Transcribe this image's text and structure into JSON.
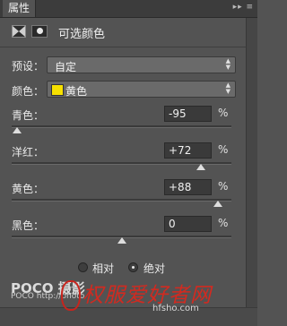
{
  "panel": {
    "tab_label": "属性",
    "title": "可选颜色"
  },
  "preset": {
    "label": "预设：",
    "value": "自定"
  },
  "colors": {
    "label": "颜色：",
    "value": "黄色",
    "swatch_color": "#f7e100"
  },
  "sliders": [
    {
      "label": "青色：",
      "value": "-95",
      "unit": "%",
      "level_percent": -95
    },
    {
      "label": "洋红：",
      "value": "+72",
      "unit": "%",
      "level_percent": 72
    },
    {
      "label": "黄色：",
      "value": "+88",
      "unit": "%",
      "level_percent": 88
    },
    {
      "label": "黑色：",
      "value": "0",
      "unit": "%",
      "level_percent": 0
    }
  ],
  "method": {
    "options": [
      {
        "label": "相对",
        "selected": false
      },
      {
        "label": "绝对",
        "selected": true
      }
    ]
  },
  "watermarks": {
    "poco": "POCO 摄影",
    "poco_url": "POCO http://photo",
    "brand": "权服爱好者网",
    "brand_url": "hfsho.com"
  }
}
